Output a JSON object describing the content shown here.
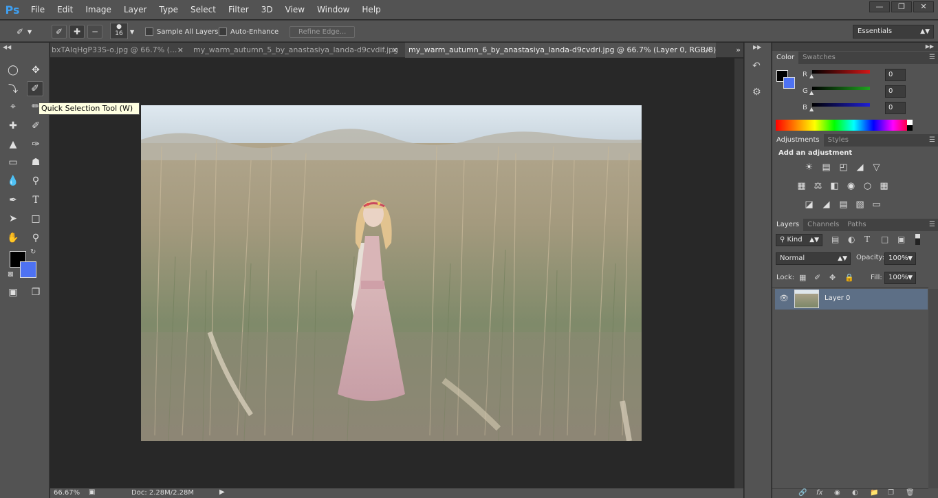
{
  "app": {
    "logo": "Ps"
  },
  "menu": [
    "File",
    "Edit",
    "Image",
    "Layer",
    "Type",
    "Select",
    "Filter",
    "3D",
    "View",
    "Window",
    "Help"
  ],
  "window_controls": [
    "minimize-icon",
    "restore-icon",
    "close-icon"
  ],
  "options_bar": {
    "brush_size": "16",
    "sample_all_layers": "Sample All Layers",
    "auto_enhance": "Auto-Enhance",
    "refine_edge": "Refine Edge...",
    "workspace": "Essentials"
  },
  "tooltip": "Quick Selection Tool (W)",
  "tabs": [
    {
      "label": "bxTAIqHgP33S-o.jpg @ 66.7% (..."
    },
    {
      "label": "my_warm_autumn_5_by_anastasiya_landa-d9cvdif.jpg"
    },
    {
      "label": "my_warm_autumn_6_by_anastasiya_landa-d9cvdri.jpg @ 66.7% (Layer 0, RGB/8) *"
    }
  ],
  "status": {
    "zoom": "66.67%",
    "doc": "Doc: 2.28M/2.28M"
  },
  "color_panel": {
    "tabs": [
      "Color",
      "Swatches"
    ],
    "channels": [
      {
        "label": "R",
        "value": "0",
        "color": "#d31616"
      },
      {
        "label": "G",
        "value": "0",
        "color": "#1fa31f"
      },
      {
        "label": "B",
        "value": "0",
        "color": "#1f1fd6"
      }
    ],
    "foreground": "#000000",
    "background": "#4e72f2"
  },
  "adjustments_panel": {
    "tabs": [
      "Adjustments",
      "Styles"
    ],
    "heading": "Add an adjustment"
  },
  "layers_panel": {
    "tabs": [
      "Layers",
      "Channels",
      "Paths"
    ],
    "filter": "Kind",
    "blend_mode": "Normal",
    "opacity_label": "Opacity:",
    "opacity": "100%",
    "lock_label": "Lock:",
    "fill_label": "Fill:",
    "fill": "100%",
    "layers": [
      {
        "name": "Layer 0",
        "visible": true
      }
    ]
  }
}
